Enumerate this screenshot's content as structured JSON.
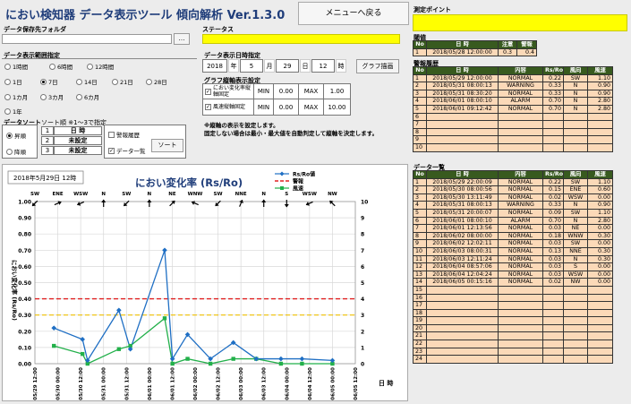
{
  "app": {
    "title": "におい検知器 データ表示ツール 傾向解析 Ver.1.3.0",
    "menu_button": "メニューへ戻る"
  },
  "folder": {
    "label": "データ保存先フォルダ",
    "browse_button": "…"
  },
  "status": {
    "label": "ステータス"
  },
  "range": {
    "label": "データ表示範囲指定",
    "options": [
      "1時間",
      "6時間",
      "12時間",
      "1日",
      "7日",
      "14日",
      "21日",
      "28日",
      "1カ月",
      "3カ月",
      "6カ月",
      "1年"
    ],
    "selected": "7日"
  },
  "datetime": {
    "label": "データ表示日時指定",
    "year": "2018",
    "year_unit": "年",
    "month": "5",
    "month_unit": "月",
    "day": "29",
    "day_unit": "日",
    "hour": "12",
    "hour_unit": "時",
    "draw_button": "グラフ描画"
  },
  "axis_setting": {
    "label": "グラフ縦軸表示設定",
    "rows": [
      {
        "name": "におい変化率縦軸固定",
        "checked": true,
        "min_label": "MIN",
        "min": "0.00",
        "max_label": "MAX",
        "max": "1.00"
      },
      {
        "name": "風速縦軸固定",
        "checked": true,
        "min_label": "MIN",
        "min": "0.00",
        "max_label": "MAX",
        "max": "10.00"
      }
    ],
    "note1": "※縦軸の表示を設定します。",
    "note2": "固定しない場合は最小・最大値を自動判定して縦軸を決定します。"
  },
  "sort": {
    "label": "データソート",
    "sublabel": "ソート順 ※1～3で指定",
    "order_options": [
      "昇順",
      "降順"
    ],
    "order_selected": "昇順",
    "keys": [
      {
        "no": "1",
        "value": "日 時"
      },
      {
        "no": "2",
        "value": "未設定"
      },
      {
        "no": "3",
        "value": "未設定"
      }
    ],
    "checks": [
      {
        "label": "警報履歴",
        "checked": false
      },
      {
        "label": "データ一覧",
        "checked": true
      }
    ],
    "sort_button": "ソート"
  },
  "measurement": {
    "label": "測定ポイント"
  },
  "threshold": {
    "label": "閾値",
    "headers": [
      "No",
      "日 時",
      "注意",
      "警報"
    ],
    "rows": [
      [
        "1",
        "2018/05/28 12:00:00",
        "0.3",
        "0.4"
      ]
    ]
  },
  "alarm_history": {
    "label": "警報履歴",
    "headers": [
      "No",
      "日 時",
      "内容",
      "Rs/Ro",
      "風向",
      "風速"
    ],
    "rows": [
      [
        "1",
        "2018/05/29 12:00:00",
        "NORMAL",
        "0.22",
        "SW",
        "1.10"
      ],
      [
        "2",
        "2018/05/31 08:00:13",
        "WARNING",
        "0.33",
        "N",
        "0.90"
      ],
      [
        "3",
        "2018/05/31 08:30:20",
        "NORMAL",
        "0.33",
        "N",
        "0.90"
      ],
      [
        "4",
        "2018/06/01 08:00:10",
        "ALARM",
        "0.70",
        "N",
        "2.80"
      ],
      [
        "5",
        "2018/06/01 09:12:42",
        "NORMAL",
        "0.70",
        "N",
        "2.80"
      ],
      [
        "6",
        "",
        "",
        "",
        "",
        ""
      ],
      [
        "7",
        "",
        "",
        "",
        "",
        ""
      ],
      [
        "8",
        "",
        "",
        "",
        "",
        ""
      ],
      [
        "9",
        "",
        "",
        "",
        "",
        ""
      ],
      [
        "10",
        "",
        "",
        "",
        "",
        ""
      ]
    ]
  },
  "data_list": {
    "label": "データ一覧",
    "headers": [
      "No",
      "日 時",
      "内容",
      "Rs/Ro",
      "風向",
      "風速"
    ],
    "rows": [
      [
        "1",
        "2018/05/29 22:00:09",
        "NORMAL",
        "0.22",
        "SW",
        "1.10"
      ],
      [
        "2",
        "2018/05/30 08:00:56",
        "NORMAL",
        "0.15",
        "ENE",
        "0.60"
      ],
      [
        "3",
        "2018/05/30 13:11:49",
        "NORMAL",
        "0.02",
        "WSW",
        "0.00"
      ],
      [
        "4",
        "2018/05/31 08:00:13",
        "WARNING",
        "0.33",
        "N",
        "0.90"
      ],
      [
        "5",
        "2018/05/31 20:00:07",
        "NORMAL",
        "0.09",
        "SW",
        "1.10"
      ],
      [
        "6",
        "2018/06/01 08:00:10",
        "ALARM",
        "0.70",
        "N",
        "2.80"
      ],
      [
        "7",
        "2018/06/01 12:13:56",
        "NORMAL",
        "0.03",
        "NE",
        "0.00"
      ],
      [
        "8",
        "2018/06/02 08:00:00",
        "NORMAL",
        "0.18",
        "WNW",
        "0.30"
      ],
      [
        "9",
        "2018/06/02 12:02:11",
        "NORMAL",
        "0.03",
        "SW",
        "0.00"
      ],
      [
        "10",
        "2018/06/03 08:00:31",
        "NORMAL",
        "0.13",
        "NNE",
        "0.30"
      ],
      [
        "11",
        "2018/06/03 12:11:24",
        "NORMAL",
        "0.03",
        "N",
        "0.30"
      ],
      [
        "12",
        "2018/06/04 08:57:06",
        "NORMAL",
        "0.03",
        "S",
        "0.00"
      ],
      [
        "13",
        "2018/06/04 12:04:24",
        "NORMAL",
        "0.03",
        "WSW",
        "0.00"
      ],
      [
        "14",
        "2018/06/05 00:15:16",
        "NORMAL",
        "0.02",
        "NW",
        "0.00"
      ],
      [
        "15",
        "",
        "",
        "",
        "",
        ""
      ],
      [
        "16",
        "",
        "",
        "",
        "",
        ""
      ],
      [
        "17",
        "",
        "",
        "",
        "",
        ""
      ],
      [
        "18",
        "",
        "",
        "",
        "",
        ""
      ],
      [
        "19",
        "",
        "",
        "",
        "",
        ""
      ],
      [
        "20",
        "",
        "",
        "",
        "",
        ""
      ],
      [
        "21",
        "",
        "",
        "",
        "",
        ""
      ],
      [
        "22",
        "",
        "",
        "",
        "",
        ""
      ],
      [
        "23",
        "",
        "",
        "",
        "",
        ""
      ],
      [
        "24",
        "",
        "",
        "",
        "",
        ""
      ]
    ]
  },
  "chart_data": {
    "type": "line",
    "title": "におい変化率 (Rs/Ro)",
    "date_label": "2018年5月29日 12時",
    "ylabel": "におい変化率 (Rs/Ro)",
    "y2label_value": "日 時",
    "ylim": [
      0,
      1
    ],
    "y2lim": [
      0,
      10
    ],
    "y_ticks": [
      "0.00",
      "0.10",
      "0.20",
      "0.30",
      "0.40",
      "0.50",
      "0.60",
      "0.70",
      "0.80",
      "0.90",
      "1.00"
    ],
    "y2_ticks": [
      "0",
      "1",
      "2",
      "3",
      "4",
      "5",
      "6",
      "7",
      "8",
      "9",
      "10"
    ],
    "x_ticks": [
      "05/29 12:00",
      "05/30 00:00",
      "05/30 12:00",
      "05/31 00:00",
      "05/31 12:00",
      "06/01 00:00",
      "06/01 12:00",
      "06/02 00:00",
      "06/02 12:00",
      "06/03 00:00",
      "06/03 12:00",
      "06/04 00:00",
      "06/04 12:00",
      "06/05 00:00",
      "06/05 12:00"
    ],
    "xlabel": "日 時",
    "wind_dirs": [
      "SW",
      "ENE",
      "WSW",
      "N",
      "SW",
      "N",
      "NE",
      "WNW",
      "SW",
      "NNE",
      "N",
      "S",
      "WSW",
      "NW"
    ],
    "legend": [
      "Rs/Ro値",
      "警報",
      "風速"
    ],
    "colors": {
      "rsro": "#1f6fc4",
      "alarm": "#e02020",
      "warning": "#f0c000",
      "wind": "#22b04a"
    },
    "alarm_level": 0.4,
    "warning_level": 0.3,
    "series": [
      {
        "name": "Rs/Ro値",
        "x": [
          0.83,
          2.08,
          2.3,
          3.67,
          4.17,
          5.67,
          6.01,
          6.67,
          7.67,
          8.67,
          9.67,
          10.75,
          11.67,
          13.0
        ],
        "values": [
          0.22,
          0.15,
          0.02,
          0.33,
          0.09,
          0.7,
          0.03,
          0.18,
          0.03,
          0.13,
          0.03,
          0.03,
          0.03,
          0.02
        ]
      },
      {
        "name": "風速",
        "x": [
          0.83,
          2.08,
          2.3,
          3.67,
          4.17,
          5.67,
          6.01,
          6.67,
          7.67,
          8.67,
          9.67,
          10.75,
          11.67,
          13.0
        ],
        "values": [
          1.1,
          0.6,
          0.0,
          0.9,
          1.1,
          2.8,
          0.0,
          0.3,
          0.0,
          0.3,
          0.3,
          0.0,
          0.0,
          0.0
        ]
      }
    ]
  }
}
